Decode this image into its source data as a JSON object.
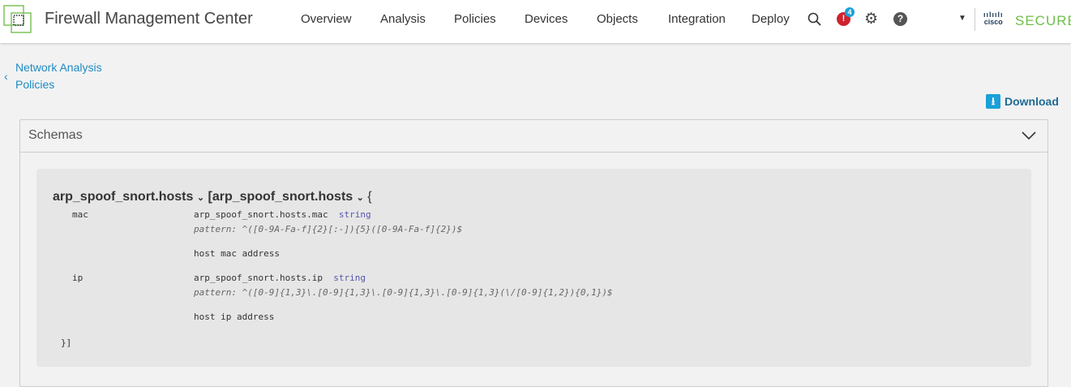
{
  "header": {
    "app_title": "Firewall Management Center",
    "nav": [
      "Overview",
      "Analysis",
      "Policies",
      "Devices",
      "Objects",
      "Integration",
      "Deploy"
    ],
    "alert_count": "4",
    "brand_small": "cisco",
    "brand": "SECURE"
  },
  "breadcrumb": {
    "line1": "Network Analysis",
    "line2": "Policies"
  },
  "download_label": "Download",
  "panel": {
    "title": "Schemas"
  },
  "schema": {
    "name": "arp_spoof_snort.hosts",
    "inner_name": "[arp_spoof_snort.hosts",
    "open_brace": "{",
    "close": "}]",
    "fields": [
      {
        "key": "mac",
        "path": "arp_spoof_snort.hosts.mac",
        "type": "string",
        "pattern": "pattern: ^([0-9A-Fa-f]{2}[:-]){5}([0-9A-Fa-f]{2})$",
        "desc": "host mac address"
      },
      {
        "key": "ip",
        "path": "arp_spoof_snort.hosts.ip",
        "type": "string",
        "pattern": "pattern: ^([0-9]{1,3}\\.[0-9]{1,3}\\.[0-9]{1,3}\\.[0-9]{1,3}(\\/[0-9]{1,2}){0,1})$",
        "desc": "host ip address"
      }
    ]
  }
}
